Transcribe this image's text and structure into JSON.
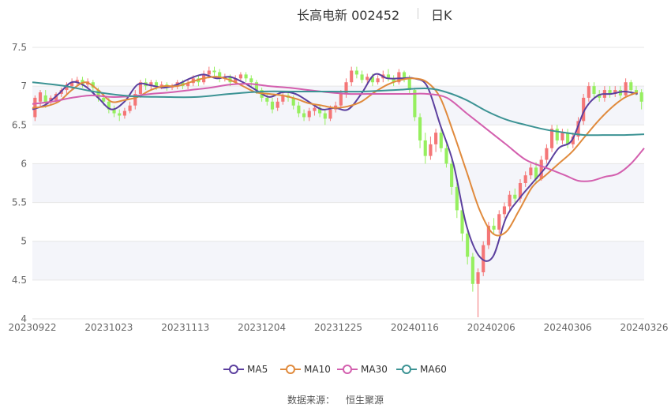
{
  "header": {
    "title": "长高电新 002452",
    "period": "日K"
  },
  "source": {
    "label": "数据来源：",
    "value": "恒生聚源"
  },
  "colors": {
    "up": "#f47677",
    "down": "#96ef5f",
    "ma5": "#5b3f9e",
    "ma10": "#e08a3c",
    "ma30": "#d35fae",
    "ma60": "#3c9394",
    "grid": "#e6e6e6",
    "band": "#f4f5fa",
    "axis_text": "#666666"
  },
  "chart_data": {
    "type": "candlestick",
    "title": "长高电新 002452",
    "period": "日K",
    "ylim": [
      4,
      7.5
    ],
    "yticks": [
      "4",
      "4.5",
      "5",
      "5.5",
      "6",
      "6.5",
      "7",
      "7.5"
    ],
    "xticks": [
      "20230922",
      "20231023",
      "20231113",
      "20231204",
      "20231225",
      "20240116",
      "20240206",
      "20240306",
      "20240326"
    ],
    "grid": true,
    "legend_position": "bottom-center",
    "series": [
      {
        "name": "MA5",
        "color": "#5b3f9e",
        "points": [
          [
            0,
            6.7
          ],
          [
            4,
            6.76
          ],
          [
            8,
            6.9
          ],
          [
            12,
            7.05
          ],
          [
            16,
            7.0
          ],
          [
            20,
            6.85
          ],
          [
            24,
            6.7
          ],
          [
            28,
            6.8
          ],
          [
            32,
            7.02
          ],
          [
            36,
            7.01
          ],
          [
            40,
            6.98
          ],
          [
            44,
            7.02
          ],
          [
            48,
            7.1
          ],
          [
            52,
            7.15
          ],
          [
            56,
            7.1
          ],
          [
            60,
            7.12
          ],
          [
            64,
            7.05
          ],
          [
            68,
            6.95
          ],
          [
            72,
            6.86
          ],
          [
            76,
            6.92
          ],
          [
            80,
            6.9
          ],
          [
            84,
            6.8
          ],
          [
            88,
            6.7
          ],
          [
            92,
            6.72
          ],
          [
            96,
            6.7
          ],
          [
            100,
            6.9
          ],
          [
            104,
            7.15
          ],
          [
            108,
            7.1
          ],
          [
            112,
            7.1
          ],
          [
            116,
            7.1
          ],
          [
            120,
            7.0
          ],
          [
            124,
            6.5
          ],
          [
            128,
            6.0
          ],
          [
            132,
            5.2
          ],
          [
            136,
            4.8
          ],
          [
            140,
            4.8
          ],
          [
            144,
            5.3
          ],
          [
            148,
            5.55
          ],
          [
            152,
            5.75
          ],
          [
            156,
            5.95
          ],
          [
            160,
            6.2
          ],
          [
            164,
            6.3
          ],
          [
            168,
            6.7
          ],
          [
            172,
            6.88
          ],
          [
            176,
            6.9
          ],
          [
            180,
            6.93
          ],
          [
            184,
            6.9
          ]
        ]
      },
      {
        "name": "MA10",
        "color": "#e08a3c",
        "points": [
          [
            0,
            6.72
          ],
          [
            4,
            6.74
          ],
          [
            8,
            6.8
          ],
          [
            12,
            6.95
          ],
          [
            16,
            7.05
          ],
          [
            20,
            6.95
          ],
          [
            24,
            6.8
          ],
          [
            28,
            6.82
          ],
          [
            32,
            6.86
          ],
          [
            36,
            6.95
          ],
          [
            40,
            7.0
          ],
          [
            44,
            7.0
          ],
          [
            48,
            7.05
          ],
          [
            52,
            7.1
          ],
          [
            56,
            7.12
          ],
          [
            60,
            7.08
          ],
          [
            64,
            7.0
          ],
          [
            68,
            6.92
          ],
          [
            72,
            6.9
          ],
          [
            76,
            6.88
          ],
          [
            80,
            6.84
          ],
          [
            84,
            6.78
          ],
          [
            88,
            6.75
          ],
          [
            92,
            6.72
          ],
          [
            96,
            6.74
          ],
          [
            100,
            6.8
          ],
          [
            104,
            6.92
          ],
          [
            108,
            7.02
          ],
          [
            112,
            7.08
          ],
          [
            116,
            7.1
          ],
          [
            120,
            7.05
          ],
          [
            124,
            6.85
          ],
          [
            128,
            6.4
          ],
          [
            132,
            5.9
          ],
          [
            136,
            5.4
          ],
          [
            140,
            5.1
          ],
          [
            144,
            5.12
          ],
          [
            148,
            5.4
          ],
          [
            152,
            5.7
          ],
          [
            156,
            5.85
          ],
          [
            160,
            6.0
          ],
          [
            164,
            6.15
          ],
          [
            168,
            6.35
          ],
          [
            172,
            6.55
          ],
          [
            176,
            6.72
          ],
          [
            180,
            6.85
          ],
          [
            184,
            6.92
          ]
        ]
      },
      {
        "name": "MA30",
        "color": "#d35fae",
        "points": [
          [
            0,
            6.77
          ],
          [
            6,
            6.8
          ],
          [
            12,
            6.85
          ],
          [
            18,
            6.88
          ],
          [
            24,
            6.86
          ],
          [
            30,
            6.87
          ],
          [
            36,
            6.9
          ],
          [
            42,
            6.92
          ],
          [
            48,
            6.95
          ],
          [
            54,
            6.98
          ],
          [
            60,
            7.02
          ],
          [
            66,
            7.03
          ],
          [
            72,
            7.0
          ],
          [
            78,
            6.98
          ],
          [
            84,
            6.95
          ],
          [
            90,
            6.92
          ],
          [
            96,
            6.9
          ],
          [
            102,
            6.9
          ],
          [
            108,
            6.9
          ],
          [
            114,
            6.9
          ],
          [
            120,
            6.9
          ],
          [
            126,
            6.85
          ],
          [
            132,
            6.65
          ],
          [
            138,
            6.45
          ],
          [
            144,
            6.25
          ],
          [
            150,
            6.05
          ],
          [
            156,
            5.95
          ],
          [
            162,
            5.85
          ],
          [
            166,
            5.78
          ],
          [
            170,
            5.78
          ],
          [
            174,
            5.83
          ],
          [
            178,
            5.87
          ],
          [
            182,
            6.0
          ],
          [
            186,
            6.2
          ]
        ]
      },
      {
        "name": "MA60",
        "color": "#3c9394",
        "points": [
          [
            0,
            7.05
          ],
          [
            10,
            7.0
          ],
          [
            20,
            6.92
          ],
          [
            30,
            6.87
          ],
          [
            40,
            6.86
          ],
          [
            50,
            6.86
          ],
          [
            60,
            6.9
          ],
          [
            70,
            6.93
          ],
          [
            80,
            6.93
          ],
          [
            90,
            6.93
          ],
          [
            100,
            6.93
          ],
          [
            110,
            6.95
          ],
          [
            120,
            6.97
          ],
          [
            126,
            6.92
          ],
          [
            132,
            6.82
          ],
          [
            138,
            6.68
          ],
          [
            144,
            6.57
          ],
          [
            150,
            6.5
          ],
          [
            156,
            6.44
          ],
          [
            162,
            6.4
          ],
          [
            168,
            6.37
          ],
          [
            174,
            6.37
          ],
          [
            180,
            6.37
          ],
          [
            186,
            6.38
          ]
        ]
      }
    ],
    "candles": [
      [
        6.6,
        6.85,
        6.88,
        6.55
      ],
      [
        6.8,
        6.92,
        6.95,
        6.72
      ],
      [
        6.88,
        6.78,
        6.95,
        6.72
      ],
      [
        6.8,
        6.85,
        6.88,
        6.75
      ],
      [
        6.82,
        6.9,
        6.92,
        6.78
      ],
      [
        6.9,
        6.95,
        6.98,
        6.86
      ],
      [
        6.95,
        7.02,
        7.05,
        6.9
      ],
      [
        7.0,
        7.05,
        7.1,
        6.96
      ],
      [
        7.05,
        7.08,
        7.12,
        7.0
      ],
      [
        7.08,
        7.02,
        7.12,
        6.98
      ],
      [
        7.02,
        7.06,
        7.1,
        6.98
      ],
      [
        7.05,
        6.98,
        7.08,
        6.94
      ],
      [
        6.95,
        6.85,
        6.98,
        6.8
      ],
      [
        6.85,
        6.8,
        6.9,
        6.75
      ],
      [
        6.8,
        6.7,
        6.85,
        6.65
      ],
      [
        6.7,
        6.65,
        6.75,
        6.6
      ],
      [
        6.65,
        6.62,
        6.7,
        6.55
      ],
      [
        6.62,
        6.68,
        6.72,
        6.58
      ],
      [
        6.68,
        6.75,
        6.8,
        6.65
      ],
      [
        6.75,
        6.9,
        6.95,
        6.7
      ],
      [
        6.9,
        7.05,
        7.08,
        6.85
      ],
      [
        7.05,
        7.0,
        7.1,
        6.95
      ],
      [
        7.0,
        7.05,
        7.08,
        6.96
      ],
      [
        7.05,
        7.0,
        7.08,
        6.95
      ],
      [
        7.0,
        7.02,
        7.06,
        6.96
      ],
      [
        7.02,
        6.98,
        7.05,
        6.94
      ],
      [
        6.98,
        7.0,
        7.03,
        6.95
      ],
      [
        7.0,
        7.05,
        7.08,
        6.96
      ],
      [
        7.05,
        7.0,
        7.08,
        6.96
      ],
      [
        7.0,
        7.04,
        7.08,
        6.96
      ],
      [
        7.04,
        7.1,
        7.14,
        7.0
      ],
      [
        7.1,
        7.05,
        7.14,
        7.0
      ],
      [
        7.05,
        7.15,
        7.2,
        7.02
      ],
      [
        7.15,
        7.2,
        7.25,
        7.1
      ],
      [
        7.2,
        7.18,
        7.25,
        7.12
      ],
      [
        7.18,
        7.1,
        7.22,
        7.05
      ],
      [
        7.1,
        7.12,
        7.16,
        7.06
      ],
      [
        7.12,
        7.05,
        7.15,
        7.0
      ],
      [
        7.05,
        7.1,
        7.14,
        7.02
      ],
      [
        7.1,
        7.15,
        7.18,
        7.06
      ],
      [
        7.15,
        7.1,
        7.18,
        7.05
      ],
      [
        7.1,
        7.05,
        7.14,
        7.0
      ],
      [
        7.05,
        6.95,
        7.08,
        6.9
      ],
      [
        6.95,
        6.85,
        6.98,
        6.8
      ],
      [
        6.85,
        6.8,
        6.9,
        6.75
      ],
      [
        6.8,
        6.7,
        6.85,
        6.65
      ],
      [
        6.72,
        6.8,
        6.85,
        6.68
      ],
      [
        6.8,
        6.88,
        6.92,
        6.76
      ],
      [
        6.88,
        6.85,
        6.92,
        6.8
      ],
      [
        6.85,
        6.75,
        6.88,
        6.7
      ],
      [
        6.75,
        6.65,
        6.8,
        6.6
      ],
      [
        6.65,
        6.6,
        6.7,
        6.55
      ],
      [
        6.6,
        6.68,
        6.72,
        6.55
      ],
      [
        6.68,
        6.72,
        6.76,
        6.62
      ],
      [
        6.72,
        6.65,
        6.76,
        6.6
      ],
      [
        6.65,
        6.58,
        6.7,
        6.5
      ],
      [
        6.58,
        6.7,
        6.75,
        6.55
      ],
      [
        6.7,
        6.75,
        6.8,
        6.66
      ],
      [
        6.75,
        6.9,
        6.95,
        6.72
      ],
      [
        6.9,
        7.05,
        7.1,
        6.85
      ],
      [
        7.05,
        7.2,
        7.25,
        7.0
      ],
      [
        7.2,
        7.15,
        7.25,
        7.1
      ],
      [
        7.15,
        7.08,
        7.2,
        7.04
      ],
      [
        7.08,
        7.12,
        7.16,
        7.04
      ],
      [
        7.12,
        7.05,
        7.16,
        7.0
      ],
      [
        7.05,
        7.1,
        7.14,
        7.02
      ],
      [
        7.1,
        7.15,
        7.2,
        7.05
      ],
      [
        7.15,
        7.1,
        7.22,
        7.06
      ],
      [
        7.1,
        7.05,
        7.14,
        7.0
      ],
      [
        7.05,
        7.18,
        7.22,
        7.02
      ],
      [
        7.18,
        7.1,
        7.2,
        7.05
      ],
      [
        7.1,
        6.95,
        7.14,
        6.9
      ],
      [
        6.95,
        6.6,
        6.98,
        6.55
      ],
      [
        6.6,
        6.3,
        6.65,
        6.2
      ],
      [
        6.3,
        6.1,
        6.4,
        6.0
      ],
      [
        6.1,
        6.25,
        6.35,
        6.05
      ],
      [
        6.25,
        6.4,
        6.45,
        6.15
      ],
      [
        6.4,
        6.2,
        6.45,
        6.15
      ],
      [
        6.2,
        6.0,
        6.25,
        5.95
      ],
      [
        6.0,
        5.7,
        6.05,
        5.6
      ],
      [
        5.7,
        5.4,
        5.75,
        5.3
      ],
      [
        5.4,
        5.1,
        5.45,
        5.0
      ],
      [
        5.1,
        4.8,
        5.15,
        4.7
      ],
      [
        4.8,
        4.45,
        4.85,
        4.35
      ],
      [
        4.45,
        4.6,
        4.65,
        4.02
      ],
      [
        4.6,
        4.95,
        5.0,
        4.55
      ],
      [
        4.95,
        5.2,
        5.25,
        4.9
      ],
      [
        5.2,
        5.15,
        5.3,
        5.1
      ],
      [
        5.15,
        5.35,
        5.4,
        5.1
      ],
      [
        5.35,
        5.45,
        5.5,
        5.3
      ],
      [
        5.45,
        5.6,
        5.65,
        5.4
      ],
      [
        5.6,
        5.55,
        5.68,
        5.5
      ],
      [
        5.55,
        5.75,
        5.8,
        5.5
      ],
      [
        5.75,
        5.85,
        5.9,
        5.7
      ],
      [
        5.85,
        5.95,
        6.0,
        5.8
      ],
      [
        5.95,
        5.8,
        6.02,
        5.75
      ],
      [
        5.8,
        6.05,
        6.1,
        5.78
      ],
      [
        6.05,
        6.2,
        6.25,
        6.0
      ],
      [
        6.2,
        6.45,
        6.5,
        6.15
      ],
      [
        6.45,
        6.3,
        6.5,
        6.25
      ],
      [
        6.3,
        6.4,
        6.45,
        6.25
      ],
      [
        6.4,
        6.25,
        6.45,
        6.2
      ],
      [
        6.25,
        6.35,
        6.4,
        6.2
      ],
      [
        6.35,
        6.55,
        6.6,
        6.3
      ],
      [
        6.55,
        6.85,
        6.9,
        6.5
      ],
      [
        6.85,
        7.0,
        7.05,
        6.8
      ],
      [
        7.0,
        6.9,
        7.05,
        6.85
      ],
      [
        6.9,
        6.85,
        6.95,
        6.8
      ],
      [
        6.85,
        6.95,
        7.0,
        6.8
      ],
      [
        6.95,
        6.9,
        7.0,
        6.85
      ],
      [
        6.9,
        6.95,
        7.0,
        6.86
      ],
      [
        6.95,
        6.88,
        7.0,
        6.84
      ],
      [
        6.88,
        7.05,
        7.1,
        6.85
      ],
      [
        7.05,
        6.95,
        7.08,
        6.9
      ],
      [
        6.95,
        6.92,
        7.0,
        6.88
      ],
      [
        6.92,
        6.8,
        6.96,
        6.7
      ]
    ]
  }
}
